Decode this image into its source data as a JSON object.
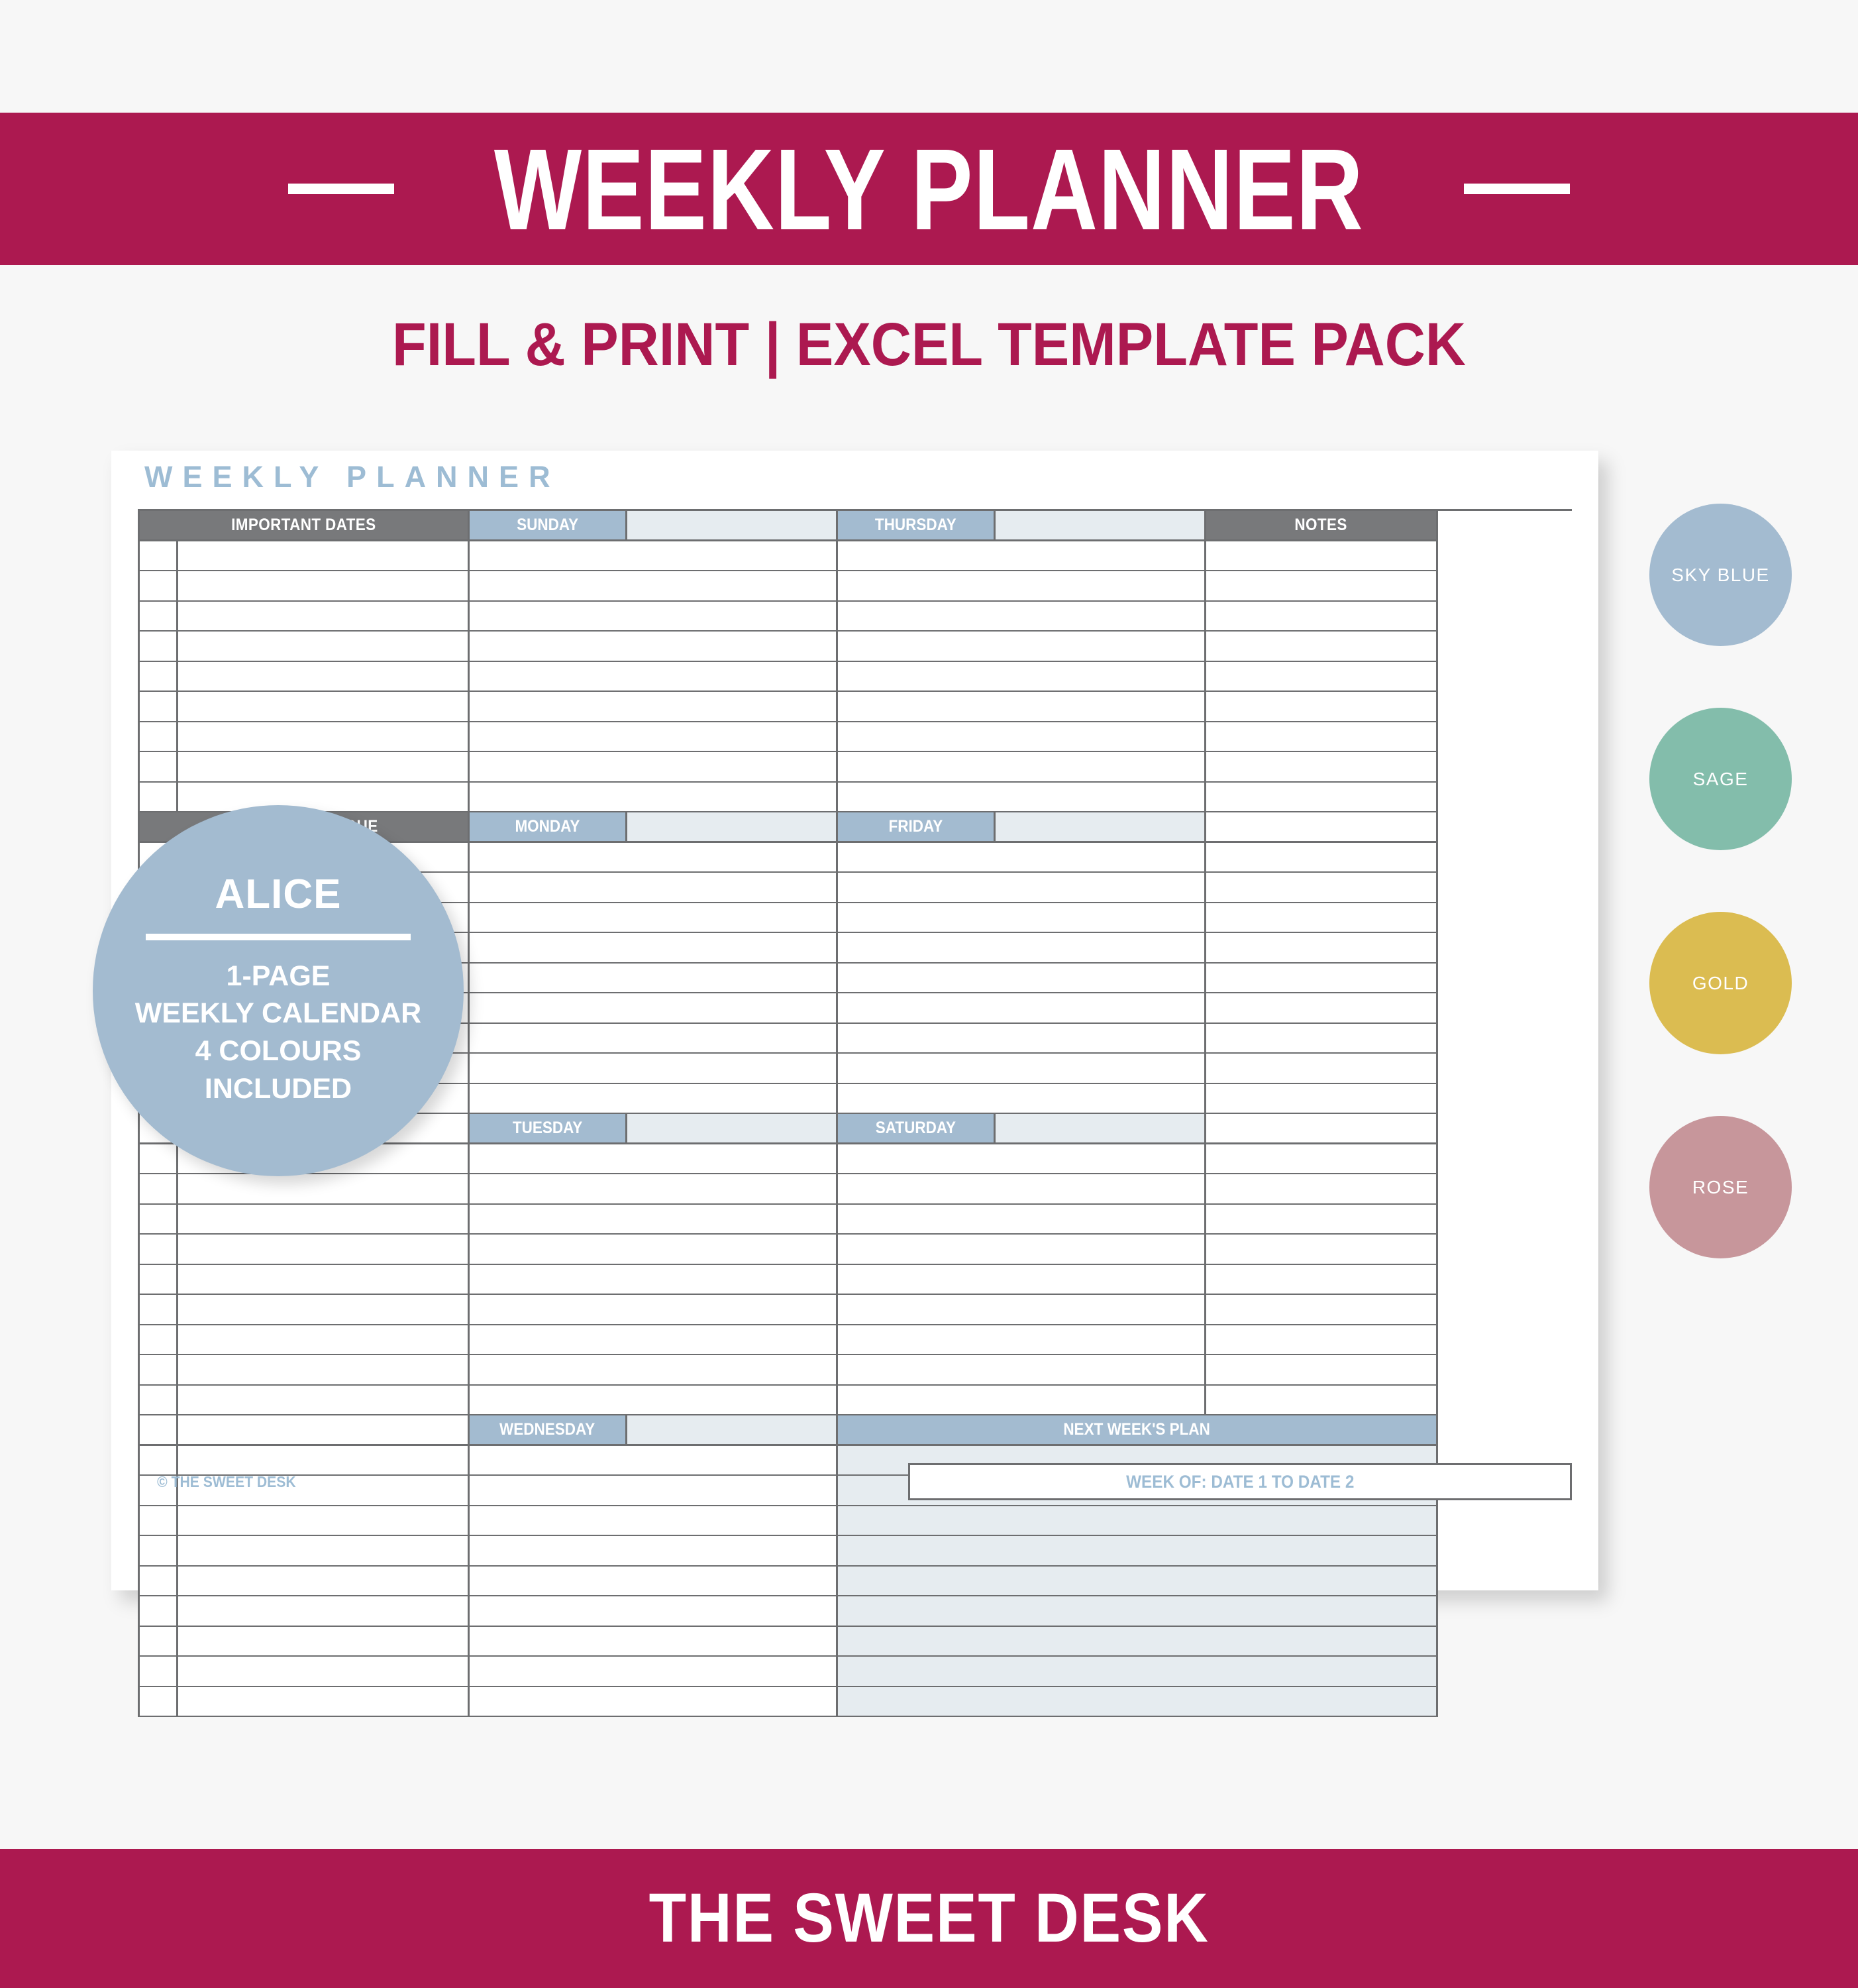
{
  "banner": {
    "title": "WEEKLY PLANNER",
    "accent_color": "#ac1950"
  },
  "subtitle": "FILL & PRINT | EXCEL TEMPLATE PACK",
  "planner": {
    "heading": "WEEKLY PLANNER",
    "header_gray_color": "#78797b",
    "header_blue_color": "#a3bbd0",
    "fill_tint_color": "#e6ecf0",
    "heading_text_color": "#9dbcd4",
    "sections": [
      {
        "left_label": "IMPORTANT DATES",
        "day_a": "SUNDAY",
        "day_b": "THURSDAY",
        "right_label": "NOTES",
        "rows": 9
      },
      {
        "left_label": "ASSIGNMENTS DUE",
        "day_a": "MONDAY",
        "day_b": "FRIDAY",
        "right_label": "",
        "rows": 9
      },
      {
        "left_label": "",
        "day_a": "TUESDAY",
        "day_b": "SATURDAY",
        "right_label": "",
        "rows": 9
      },
      {
        "left_label": "",
        "day_a": "WEDNESDAY",
        "day_b": "",
        "right_label": "NEXT WEEK'S PLAN",
        "rows": 9
      }
    ],
    "footer": {
      "copyright": "© THE SWEET DESK",
      "week_of": "WEEK OF: DATE 1 TO DATE 2"
    }
  },
  "badge": {
    "title": "ALICE",
    "line1": "1-PAGE",
    "line2": "WEEKLY CALENDAR",
    "line3": "4 COLOURS",
    "line4": "INCLUDED",
    "color": "#a3bbd0"
  },
  "swatches": [
    {
      "label": "SKY BLUE",
      "color": "#a3bbd0"
    },
    {
      "label": "SAGE",
      "color": "#83bdab"
    },
    {
      "label": "GOLD",
      "color": "#dbbc51"
    },
    {
      "label": "ROSE",
      "color": "#c7969b"
    }
  ],
  "footer_banner": {
    "text": "THE SWEET DESK"
  }
}
